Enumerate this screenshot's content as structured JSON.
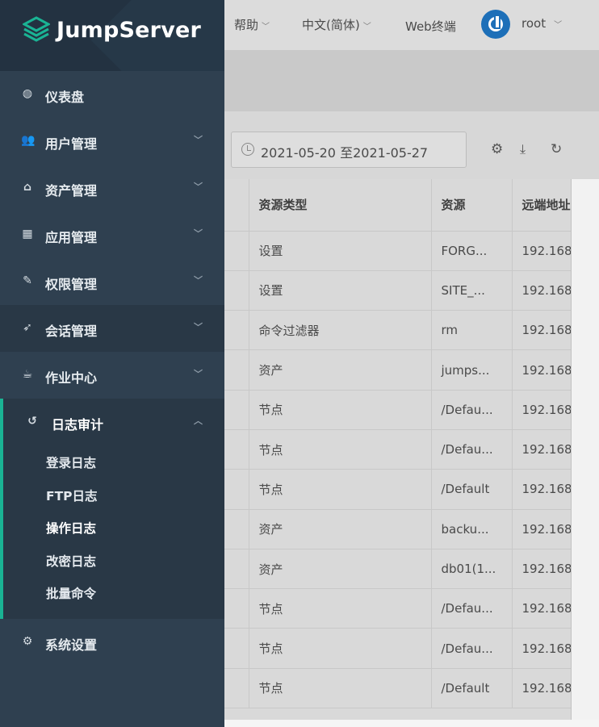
{
  "brand": {
    "name": "JumpServer"
  },
  "colors": {
    "sidebar_bg": "#2f4050",
    "sidebar_active_bg": "#293846",
    "accent": "#1ab394",
    "logo_green": "#1ab394",
    "user_icon_blue": "#1d6fb8"
  },
  "topbar": {
    "help": "帮助",
    "language": "中文(简体)",
    "web_terminal": "Web终端",
    "user": "root"
  },
  "sidebar": {
    "items": [
      {
        "label": "仪表盘",
        "icon": "dashboard-icon",
        "has_arrow": false
      },
      {
        "label": "用户管理",
        "icon": "users-icon",
        "has_arrow": true
      },
      {
        "label": "资产管理",
        "icon": "inbox-icon",
        "has_arrow": true
      },
      {
        "label": "应用管理",
        "icon": "grid-icon",
        "has_arrow": true
      },
      {
        "label": "权限管理",
        "icon": "edit-icon",
        "has_arrow": true
      },
      {
        "label": "会话管理",
        "icon": "rocket-icon",
        "has_arrow": true
      },
      {
        "label": "作业中心",
        "icon": "coffee-icon",
        "has_arrow": true
      },
      {
        "label": "日志审计",
        "icon": "history-icon",
        "has_arrow": true,
        "expanded": true
      },
      {
        "label": "系统设置",
        "icon": "cogs-icon",
        "has_arrow": false
      }
    ],
    "log_audit_sub": [
      "登录日志",
      "FTP日志",
      "操作日志",
      "改密日志",
      "批量命令"
    ],
    "current_sub": "操作日志"
  },
  "toolbar": {
    "date_start": "2021-05-20",
    "date_sep": "至",
    "date_end": "2021-05-27"
  },
  "table": {
    "columns": [
      "资源类型",
      "资源",
      "远端地址"
    ],
    "rows": [
      [
        "设置",
        "FORG...",
        "192.168"
      ],
      [
        "设置",
        "SITE_...",
        "192.168"
      ],
      [
        "命令过滤器",
        "rm",
        "192.168"
      ],
      [
        "资产",
        "jumps...",
        "192.168"
      ],
      [
        "节点",
        "/Defau...",
        "192.168"
      ],
      [
        "节点",
        "/Defau...",
        "192.168"
      ],
      [
        "节点",
        "/Default",
        "192.168"
      ],
      [
        "资产",
        "backu...",
        "192.168"
      ],
      [
        "资产",
        "db01(1...",
        "192.168"
      ],
      [
        "节点",
        "/Defau...",
        "192.168"
      ],
      [
        "节点",
        "/Defau...",
        "192.168"
      ],
      [
        "节点",
        "/Default",
        "192.168"
      ]
    ]
  }
}
